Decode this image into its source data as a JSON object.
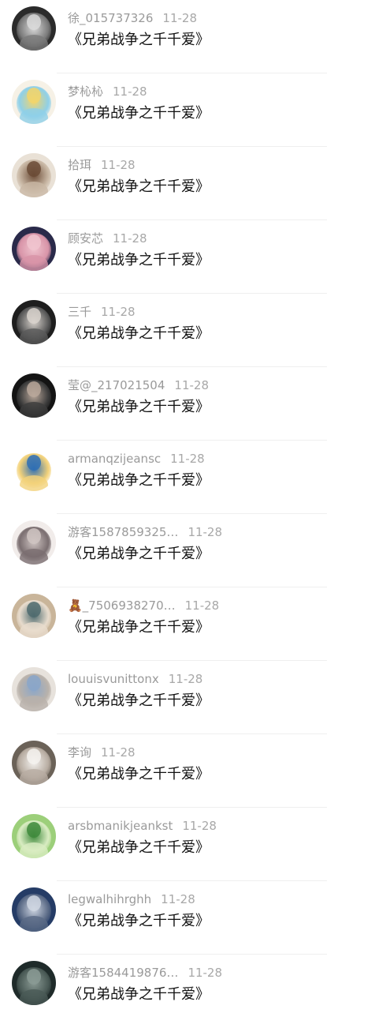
{
  "comments": [
    {
      "username": "徐_015737326",
      "date": "11-28",
      "text": "《兄弟战争之千千爱》",
      "avatar": "avatar-dolls-icon",
      "colors": [
        "#2b2b2b",
        "#d9d9d9",
        "#7a7a7a"
      ]
    },
    {
      "username": "梦杺杺",
      "date": "11-28",
      "text": "《兄弟战争之千千爱》",
      "avatar": "avatar-anime-girl-icon",
      "colors": [
        "#f6f1e6",
        "#f2d56b",
        "#8fd0e8"
      ]
    },
    {
      "username": "拾珥",
      "date": "11-28",
      "text": "《兄弟战争之千千爱》",
      "avatar": "avatar-sketch-girl-icon",
      "colors": [
        "#e9e1d6",
        "#6b4b36",
        "#c9b8a5"
      ]
    },
    {
      "username": "顾安芯",
      "date": "11-28",
      "text": "《兄弟战争之千千爱》",
      "avatar": "avatar-pink-girl-icon",
      "colors": [
        "#2a2a4a",
        "#f0c4cf",
        "#d894a8"
      ]
    },
    {
      "username": "三千",
      "date": "11-28",
      "text": "《兄弟战争之千千爱》",
      "avatar": "avatar-dark-portrait-icon",
      "colors": [
        "#1e1e1e",
        "#d8d2cc",
        "#5a5a5a"
      ]
    },
    {
      "username": "莹@_217021504",
      "date": "11-28",
      "text": "《兄弟战争之千千爱》",
      "avatar": "avatar-dark-couple-icon",
      "colors": [
        "#141414",
        "#b9a79a",
        "#3c3c3c"
      ]
    },
    {
      "username": "armanqzijeansc",
      "date": "11-28",
      "text": "《兄弟战争之千千爱》",
      "avatar": "avatar-cartoon-guard-icon",
      "colors": [
        "#ffffff",
        "#2f6fb4",
        "#f3d27a"
      ]
    },
    {
      "username": "游客1587859325…",
      "date": "11-28",
      "text": "《兄弟战争之千千爱》",
      "avatar": "avatar-white-hair-girl-icon",
      "colors": [
        "#f1ecea",
        "#cfc4c2",
        "#7a6e70"
      ]
    },
    {
      "username": "🧸_7506938270…",
      "date": "11-28",
      "text": "《兄弟战争之千千爱》",
      "avatar": "avatar-two-kids-icon",
      "colors": [
        "#c9b59a",
        "#4f6b6f",
        "#e8dccd"
      ]
    },
    {
      "username": "louuisvunittonx",
      "date": "11-28",
      "text": "《兄弟战争之千千爱》",
      "avatar": "avatar-girl-lying-icon",
      "colors": [
        "#e7e2dc",
        "#8aa6c9",
        "#b9b2ab"
      ]
    },
    {
      "username": "李询",
      "date": "11-28",
      "text": "《兄弟战争之千千爱》",
      "avatar": "avatar-white-cat-icon",
      "colors": [
        "#6b6258",
        "#f4f2ef",
        "#b8ada2"
      ]
    },
    {
      "username": "arsbmanikjeankst",
      "date": "11-28",
      "text": "《兄弟战争之千千爱》",
      "avatar": "avatar-green-leaf-icon",
      "colors": [
        "#9ccf7a",
        "#3f8a3c",
        "#d9ecc2"
      ]
    },
    {
      "username": "legwalhihrghh",
      "date": "11-28",
      "text": "《兄弟战争之千千爱》",
      "avatar": "avatar-snow-leopard-icon",
      "colors": [
        "#253c66",
        "#cfd6e2",
        "#5a6a86"
      ]
    },
    {
      "username": "游客1584419876…",
      "date": "11-28",
      "text": "《兄弟战争之千千爱》",
      "avatar": "avatar-totoro-icon",
      "colors": [
        "#1f2b2a",
        "#8a9a94",
        "#4a5a56"
      ]
    }
  ]
}
